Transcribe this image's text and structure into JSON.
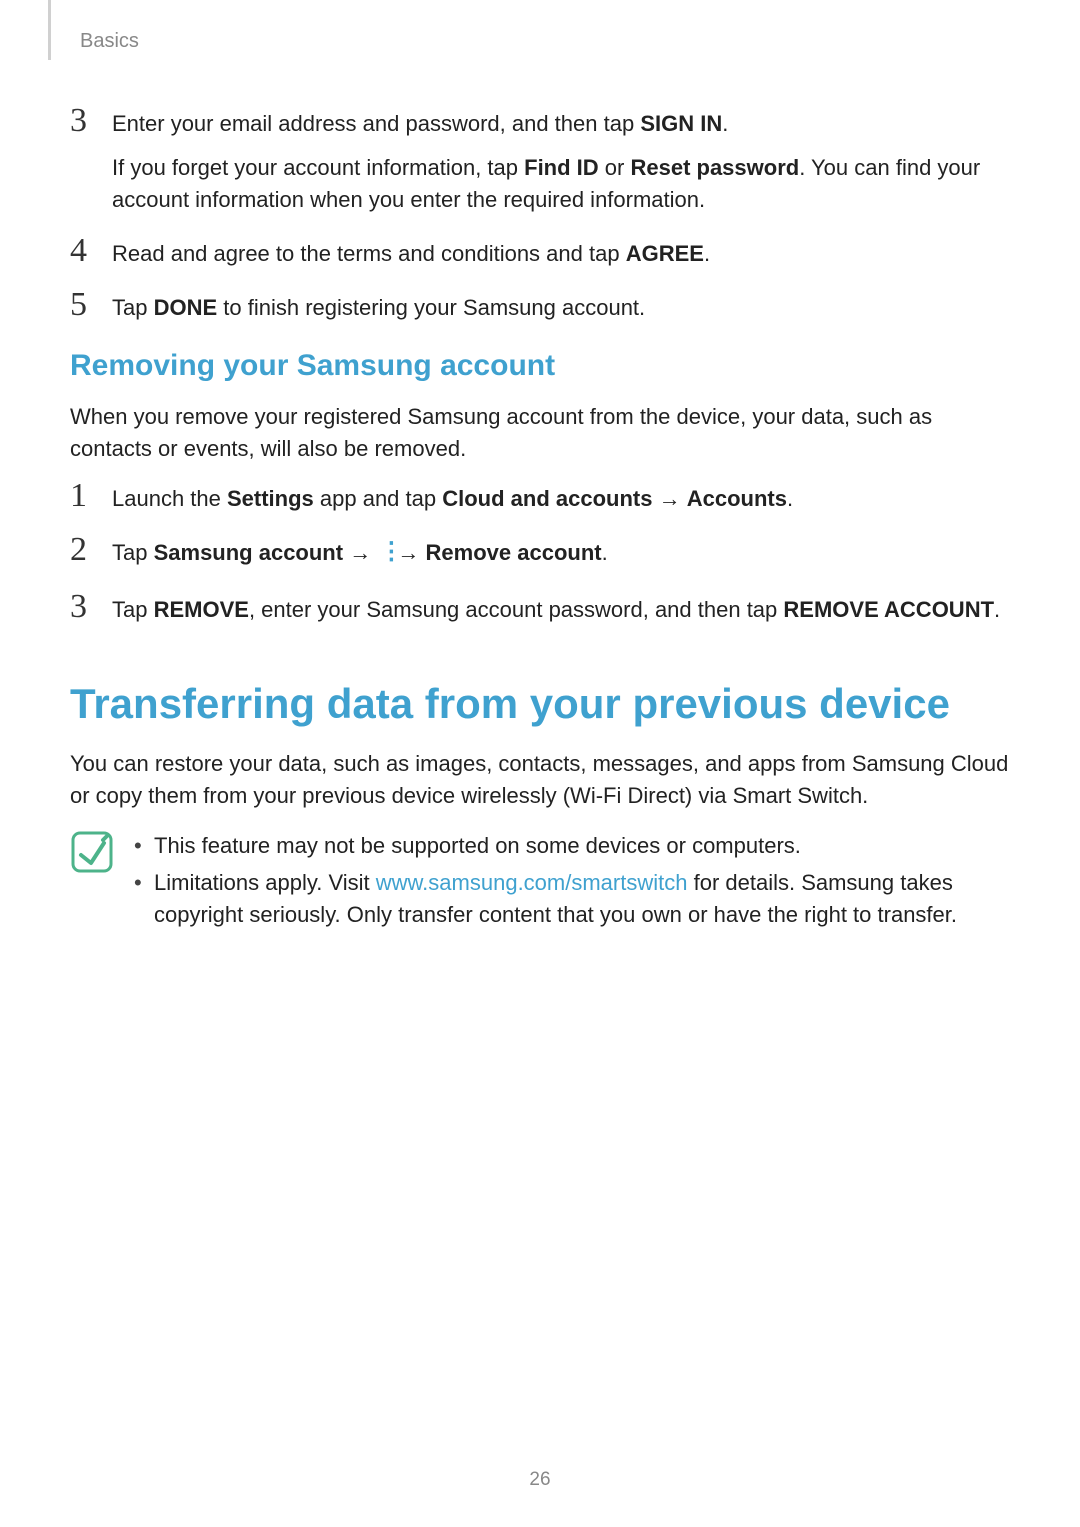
{
  "breadcrumb": "Basics",
  "stepsA": {
    "s3": {
      "num": "3",
      "line1_pre": "Enter your email address and password, and then tap ",
      "line1_bold": "SIGN IN",
      "line1_post": ".",
      "line2_pre": "If you forget your account information, tap ",
      "line2_b1": "Find ID",
      "line2_mid": " or ",
      "line2_b2": "Reset password",
      "line2_post": ". You can find your account information when you enter the required information."
    },
    "s4": {
      "num": "4",
      "pre": "Read and agree to the terms and conditions and tap ",
      "bold": "AGREE",
      "post": "."
    },
    "s5": {
      "num": "5",
      "pre": "Tap ",
      "bold": "DONE",
      "post": " to finish registering your Samsung account."
    }
  },
  "subhead1": "Removing your Samsung account",
  "subhead1_para": "When you remove your registered Samsung account from the device, your data, such as contacts or events, will also be removed.",
  "stepsB": {
    "s1": {
      "num": "1",
      "pre": "Launch the ",
      "b1": "Settings",
      "mid1": " app and tap ",
      "b2": "Cloud and accounts",
      "arr": " → ",
      "b3": "Accounts",
      "post": "."
    },
    "s2": {
      "num": "2",
      "pre": "Tap ",
      "b1": "Samsung account",
      "arr1": " → ",
      "arr2": " → ",
      "b2": "Remove account",
      "post": "."
    },
    "s3": {
      "num": "3",
      "pre": "Tap ",
      "b1": "REMOVE",
      "mid": ", enter your Samsung account password, and then tap ",
      "b2": "REMOVE ACCOUNT",
      "post": "."
    }
  },
  "mainhead": "Transferring data from your previous device",
  "mainpara": "You can restore your data, such as images, contacts, messages, and apps from Samsung Cloud or copy them from your previous device wirelessly (Wi-Fi Direct) via Smart Switch.",
  "notes": {
    "n1": "This feature may not be supported on some devices or computers.",
    "n2_pre": "Limitations apply. Visit ",
    "n2_link": "www.samsung.com/smartswitch",
    "n2_post": " for details. Samsung takes copyright seriously. Only transfer content that you own or have the right to transfer."
  },
  "pagenum": "26"
}
